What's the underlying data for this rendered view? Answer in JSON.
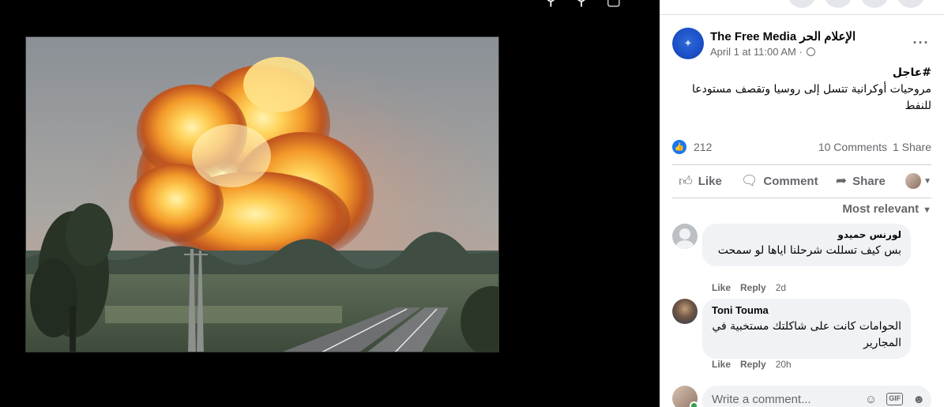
{
  "viewer": {
    "icons": [
      "search-icon",
      "zoom-icon",
      "fullscreen-icon"
    ]
  },
  "post": {
    "page_name": "The Free Media الإعلام الحر",
    "timestamp": "April 1 at 11:00 AM · ",
    "privacy_icon": "globe-icon",
    "hashtag": "#عاجل",
    "text": "مروحيات أوكرانية تتسل إلى روسيا وتقصف مستودعا للنفط",
    "like_count": "212",
    "comments_count": "10 Comments",
    "shares_count": "1 Share"
  },
  "actions": {
    "like_label": "Like",
    "comment_label": "Comment",
    "share_label": "Share"
  },
  "sort_label": "Most relevant",
  "comments": [
    {
      "author": "لورنس حميدو",
      "text": "بس كيف تسللت شرحلنا اياها لو سمحت",
      "like": "Like",
      "reply": "Reply",
      "time": "2d"
    },
    {
      "author": "Toni Touma",
      "text": "الحوامات كانت على شاكلتك مستخبية في المجارير",
      "like": "Like",
      "reply": "Reply",
      "time": "20h"
    }
  ],
  "composer": {
    "placeholder": "Write a comment...",
    "gif_label": "GIF"
  },
  "colors": {
    "brand_blue": "#1877f2",
    "panel_bg": "#ffffff",
    "bubble_bg": "#f0f2f5",
    "muted_text": "#65676b",
    "online_green": "#31a24c"
  }
}
